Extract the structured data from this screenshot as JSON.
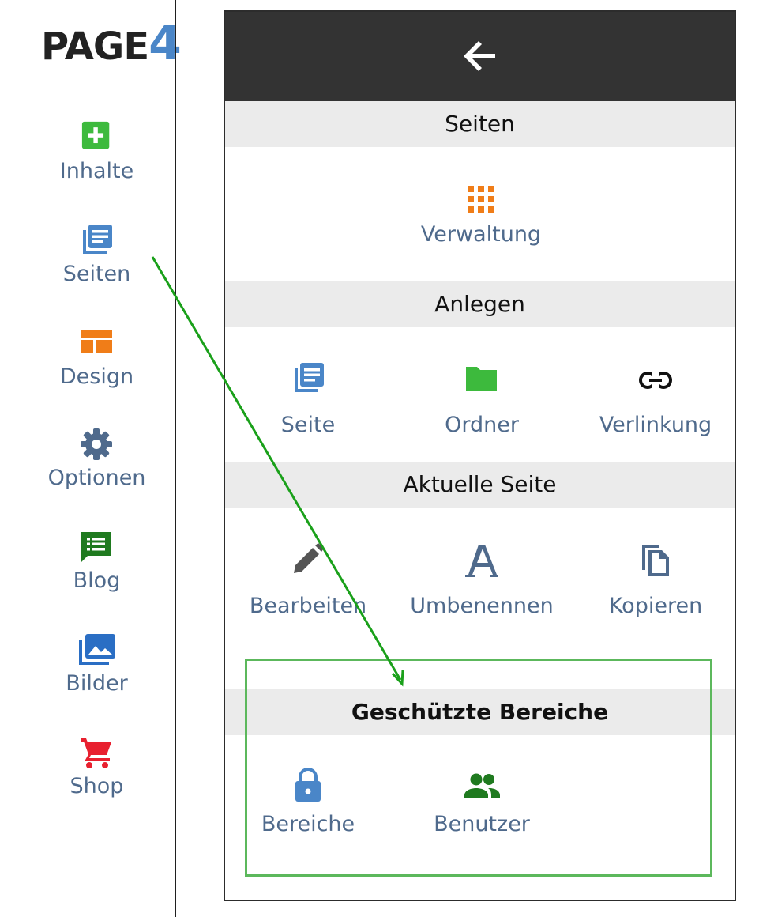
{
  "logo": {
    "text": "PAGE",
    "number": "4"
  },
  "sidebar": {
    "items": [
      {
        "label": "Inhalte",
        "icon": "add-box-icon",
        "color": "#3dba3d"
      },
      {
        "label": "Seiten",
        "icon": "pages-icon",
        "color": "#4a86c8"
      },
      {
        "label": "Design",
        "icon": "layout-icon",
        "color": "#f07d18"
      },
      {
        "label": "Optionen",
        "icon": "gear-icon",
        "color": "#4f6a8c"
      },
      {
        "label": "Blog",
        "icon": "blog-icon",
        "color": "#1f7a1f"
      },
      {
        "label": "Bilder",
        "icon": "images-icon",
        "color": "#2a6ec4"
      },
      {
        "label": "Shop",
        "icon": "cart-icon",
        "color": "#e8202f"
      }
    ]
  },
  "panel": {
    "back_icon": "arrow-left-icon",
    "sections": {
      "seiten": "Seiten",
      "anlegen": "Anlegen",
      "aktuelle": "Aktuelle Seite",
      "geschuetzt": "Geschützte Bereiche"
    },
    "seiten_tiles": [
      {
        "label": "Verwaltung",
        "icon": "grid-icon",
        "color": "#f07d18"
      }
    ],
    "anlegen_tiles": [
      {
        "label": "Seite",
        "icon": "pages-icon",
        "color": "#4a86c8"
      },
      {
        "label": "Ordner",
        "icon": "folder-icon",
        "color": "#3dba3d"
      },
      {
        "label": "Verlinkung",
        "icon": "link-icon",
        "color": "#111111"
      }
    ],
    "aktuelle_tiles": [
      {
        "label": "Bearbeiten",
        "icon": "pencil-icon",
        "color": "#555555"
      },
      {
        "label": "Umbenennen",
        "icon": "font-a-icon",
        "color": "#4f6a8c"
      },
      {
        "label": "Kopieren",
        "icon": "copy-icon",
        "color": "#4f6a8c"
      }
    ],
    "geschuetzt_tiles": [
      {
        "label": "Bereiche",
        "icon": "lock-icon",
        "color": "#4a86c8"
      },
      {
        "label": "Benutzer",
        "icon": "users-icon",
        "color": "#1f7a1f"
      }
    ]
  },
  "colors": {
    "topbar": "#333333",
    "section_bg": "#ebebeb",
    "label": "#4f6a8c",
    "highlight": "#5cb85c",
    "annotation_arrow": "#1aa01a"
  }
}
